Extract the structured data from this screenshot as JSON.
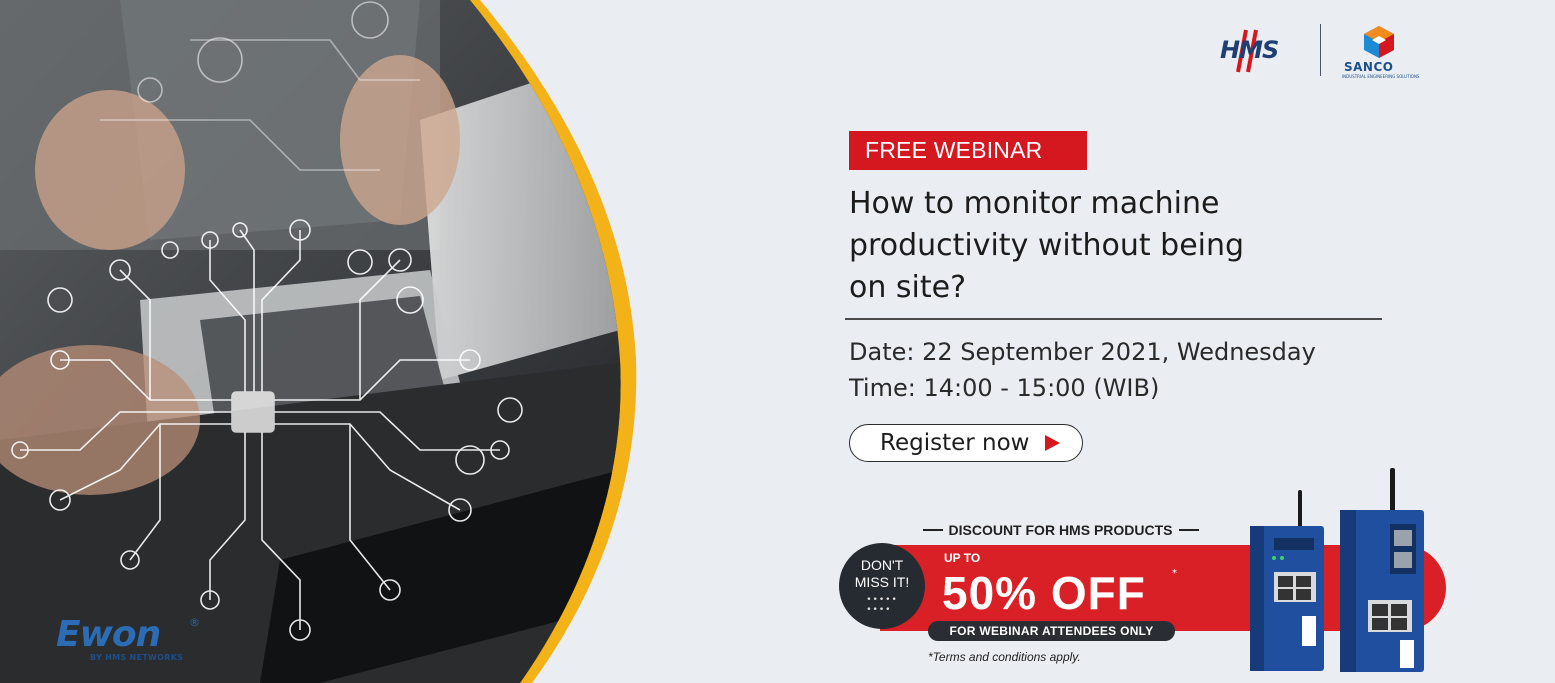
{
  "brand": {
    "ewon": "Ewon",
    "ewon_registered": "®",
    "ewon_sub": "BY HMS NETWORKS",
    "hms": "HMS",
    "sanco": "SANCO",
    "sanco_sub": "INDUSTRIAL ENGINEERING SOLUTIONS"
  },
  "webinar": {
    "tag": "FREE WEBINAR",
    "headline_lines": [
      "How to monitor machine",
      "productivity without being",
      "on site?"
    ],
    "date": "Date: 22 September 2021, Wednesday",
    "time": "Time: 14:00 - 15:00 (WIB)",
    "register_label": "Register now"
  },
  "discount": {
    "title": "DISCOUNT FOR HMS PRODUCTS",
    "badge_line1": "DON'T",
    "badge_line2": "MISS IT!",
    "badge_dots": "• • • • •\n• • • •",
    "up_to": "UP TO",
    "offer": "50% OFF",
    "offer_star": "*",
    "attendees": "FOR WEBINAR ATTENDEES ONLY",
    "terms": "*Terms and conditions apply."
  },
  "colors": {
    "accent_red": "#d5181f",
    "accent_yellow": "#f3b318",
    "brand_blue": "#2b6cb5",
    "dark": "#262a31",
    "background": "#eaeef3"
  },
  "icons": [
    "circuit-network",
    "play-triangle-icon",
    "hms-logo",
    "sanco-logo",
    "ewon-device"
  ]
}
